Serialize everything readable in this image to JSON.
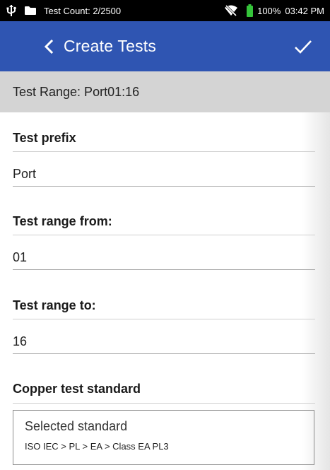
{
  "status_bar": {
    "test_count": "Test Count: 2/2500",
    "battery": "100%",
    "time": "03:42 PM",
    "icons": [
      "usb-icon",
      "folder-icon",
      "wifi-off-icon",
      "battery-icon"
    ]
  },
  "app_bar": {
    "title": "Create Tests",
    "color": "#2f55b2",
    "back_icon": "chevron-left-icon",
    "confirm_icon": "check-icon"
  },
  "range_header": {
    "text": "Test Range: Port01:16"
  },
  "form": {
    "test_prefix": {
      "label": "Test prefix",
      "value": "Port"
    },
    "range_from": {
      "label": "Test range from:",
      "value": "01"
    },
    "range_to": {
      "label": "Test range to:",
      "value": "16"
    },
    "copper_standard": {
      "label": "Copper test standard",
      "box_title": "Selected standard",
      "box_value": "ISO IEC > PL > EA > Class EA PL3"
    }
  }
}
